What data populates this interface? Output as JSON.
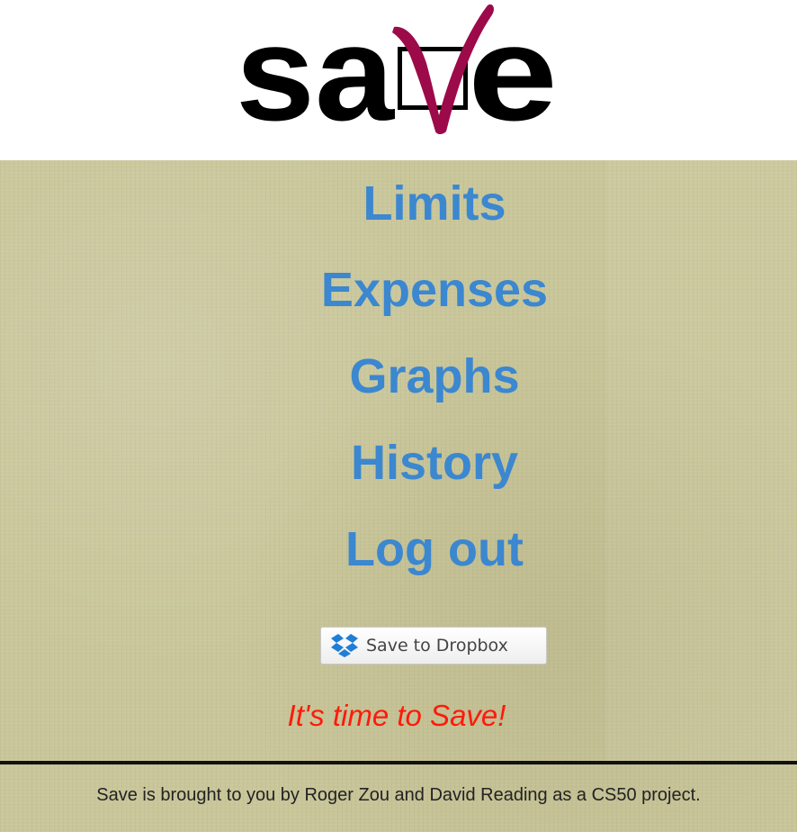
{
  "header": {
    "logo_text": "save"
  },
  "nav": {
    "items": [
      {
        "label": "Limits"
      },
      {
        "label": "Expenses"
      },
      {
        "label": "Graphs"
      },
      {
        "label": "History"
      },
      {
        "label": "Log out"
      }
    ]
  },
  "dropbox": {
    "label": "Save to Dropbox",
    "icon": "dropbox-icon"
  },
  "tagline": "It's time to Save!",
  "footer": {
    "text": "Save is brought to you by Roger Zou and David Reading as a CS50 project."
  },
  "colors": {
    "link": "#3b87d0",
    "tagline": "#ff1a0a",
    "check": "#9c0a4a",
    "background": "#c9c69a"
  }
}
